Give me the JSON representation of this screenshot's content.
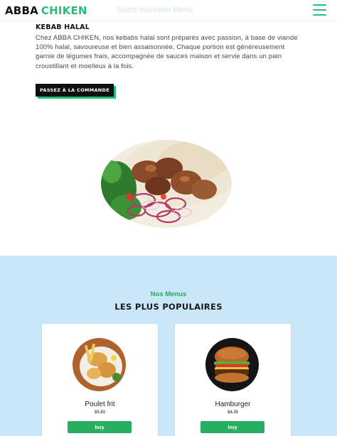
{
  "header": {
    "logo_part1": "ABBA",
    "logo_part2": "CHIKEN",
    "nav_link": "Notre nouveau Menu",
    "menu_icon": "hamburger-menu-icon",
    "accent_color": "#22c07a"
  },
  "kebab": {
    "title": "KEBAB HALAL",
    "description": "Chez ABBA CHIKEN, nos kebabs halal sont préparés avec passion, à base de viande 100% halal, savoureuse et bien assaisonnée. Chaque portion est généreusement garnie de légumes frais, accompagnée de sauces maison et servie dans un pain croustillant et moelleux à la fois.",
    "order_button": "PASSEZ À LA COMMANDE",
    "image": "kebab-plate-image"
  },
  "popular": {
    "subtitle": "Nos Menus",
    "title": "LES PLUS POPULAIRES",
    "background_color": "#c9e7f8",
    "cards": [
      {
        "name": "Poulet frit",
        "price": "$5.93",
        "button": "buy",
        "image": "fried-chicken-image"
      },
      {
        "name": "Hamburger",
        "price": "$4.35",
        "button": "buy",
        "image": "hamburger-image"
      }
    ]
  }
}
